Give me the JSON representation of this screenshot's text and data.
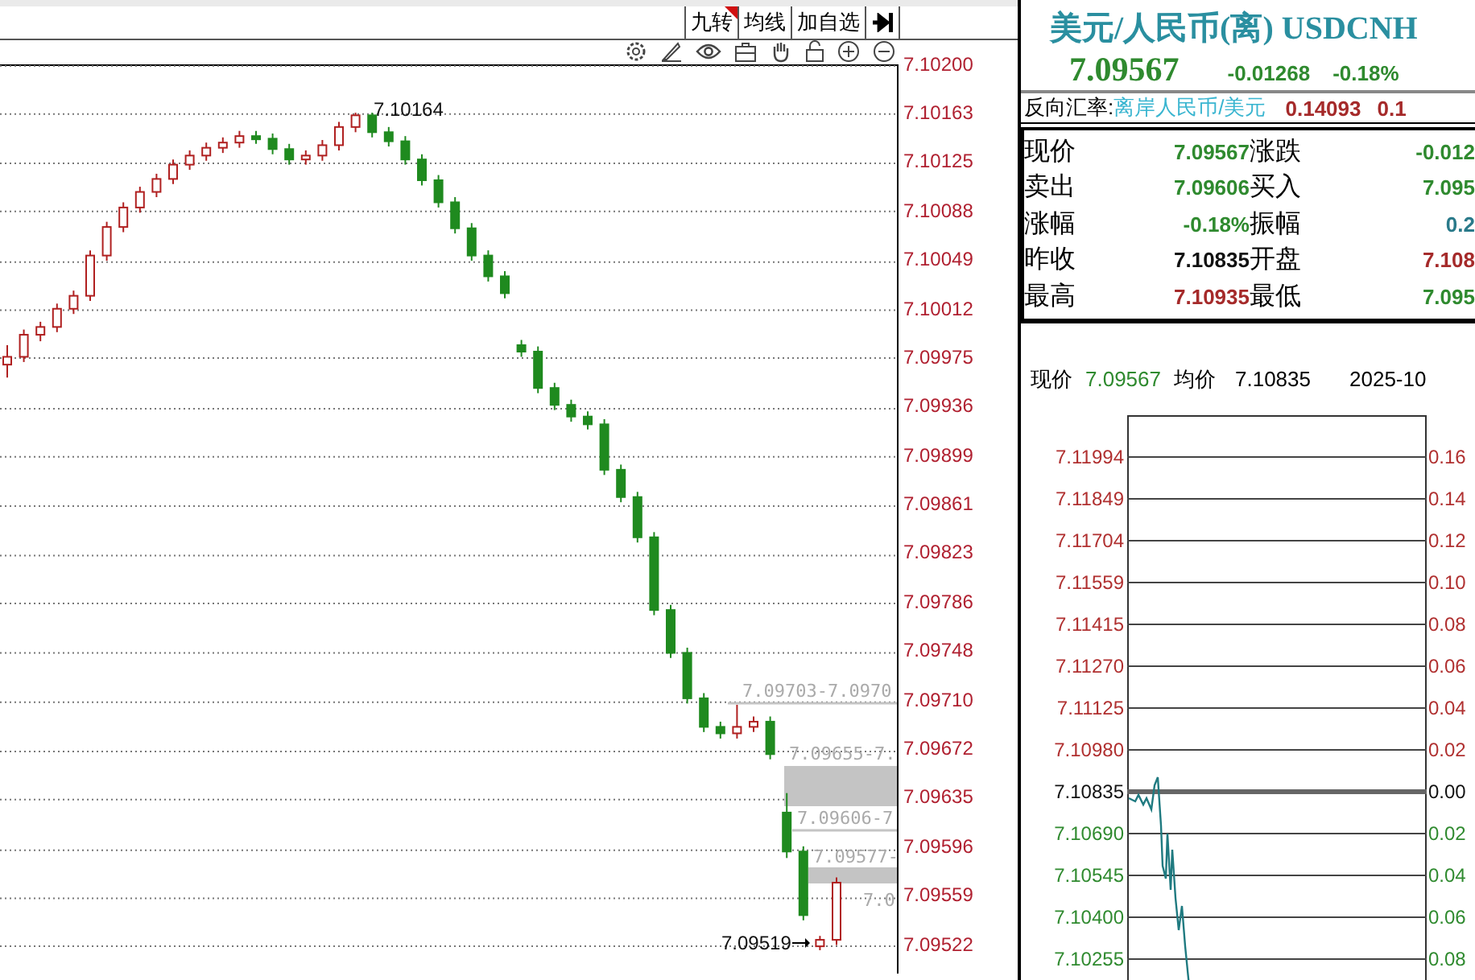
{
  "toolbar": {
    "buttons": [
      {
        "label": "九转",
        "flagged": true
      },
      {
        "label": "均线",
        "flagged": false
      },
      {
        "label": "加自选",
        "flagged": false
      }
    ]
  },
  "kline": {
    "chart_data": {
      "type": "candlestick",
      "ylim": [
        7.09501,
        7.102
      ],
      "grid": true,
      "yticks": [
        {
          "value": 7.102,
          "label": "7.10200"
        },
        {
          "value": 7.10163,
          "label": "7.10163"
        },
        {
          "value": 7.10125,
          "label": "7.10125"
        },
        {
          "value": 7.10088,
          "label": "7.10088"
        },
        {
          "value": 7.10049,
          "label": "7.10049"
        },
        {
          "value": 7.10012,
          "label": "7.10012"
        },
        {
          "value": 7.09975,
          "label": "7.09975"
        },
        {
          "value": 7.09936,
          "label": "7.09936"
        },
        {
          "value": 7.09899,
          "label": "7.09899"
        },
        {
          "value": 7.09861,
          "label": "7.09861"
        },
        {
          "value": 7.09823,
          "label": "7.09823"
        },
        {
          "value": 7.09786,
          "label": "7.09786"
        },
        {
          "value": 7.09748,
          "label": "7.09748"
        },
        {
          "value": 7.0971,
          "label": "7.09710"
        },
        {
          "value": 7.09672,
          "label": "7.09672"
        },
        {
          "value": 7.09635,
          "label": "7.09635"
        },
        {
          "value": 7.09596,
          "label": "7.09596"
        },
        {
          "value": 7.09559,
          "label": "7.09559"
        },
        {
          "value": 7.09522,
          "label": "7.09522"
        }
      ],
      "ohlc": [
        [
          7.0997,
          7.09985,
          7.0996,
          7.09976
        ],
        [
          7.09976,
          7.09997,
          7.09972,
          7.09993
        ],
        [
          7.09993,
          7.10003,
          7.09988,
          7.09999
        ],
        [
          7.09999,
          7.10017,
          7.09995,
          7.10013
        ],
        [
          7.10013,
          7.10027,
          7.10009,
          7.10023
        ],
        [
          7.10023,
          7.10058,
          7.10019,
          7.10054
        ],
        [
          7.10054,
          7.1008,
          7.1005,
          7.10076
        ],
        [
          7.10076,
          7.10095,
          7.10072,
          7.10091
        ],
        [
          7.10091,
          7.10107,
          7.10087,
          7.10103
        ],
        [
          7.10103,
          7.10117,
          7.10099,
          7.10113
        ],
        [
          7.10113,
          7.10128,
          7.10109,
          7.10124
        ],
        [
          7.10124,
          7.10135,
          7.1012,
          7.10131
        ],
        [
          7.10131,
          7.10141,
          7.10127,
          7.10137
        ],
        [
          7.10137,
          7.10145,
          7.10133,
          7.10141
        ],
        [
          7.10141,
          7.1015,
          7.10137,
          7.10146
        ],
        [
          7.10146,
          7.1015,
          7.1014,
          7.10144
        ],
        [
          7.10144,
          7.10148,
          7.10132,
          7.10136
        ],
        [
          7.10136,
          7.1014,
          7.10124,
          7.10128
        ],
        [
          7.10128,
          7.10135,
          7.10124,
          7.10131
        ],
        [
          7.10131,
          7.10143,
          7.10127,
          7.10139
        ],
        [
          7.10139,
          7.10157,
          7.10135,
          7.10153
        ],
        [
          7.10153,
          7.10164,
          7.10149,
          7.10162
        ],
        [
          7.10162,
          7.10164,
          7.10145,
          7.10149
        ],
        [
          7.10149,
          7.10153,
          7.10138,
          7.10142
        ],
        [
          7.10142,
          7.10146,
          7.10124,
          7.10128
        ],
        [
          7.10128,
          7.10132,
          7.10108,
          7.10112
        ],
        [
          7.10112,
          7.10116,
          7.10091,
          7.10095
        ],
        [
          7.10095,
          7.10099,
          7.10071,
          7.10075
        ],
        [
          7.10075,
          7.10079,
          7.1005,
          7.10054
        ],
        [
          7.10054,
          7.10058,
          7.10034,
          7.10038
        ],
        [
          7.10038,
          7.10042,
          7.10021,
          7.10025
        ],
        [
          7.09985,
          7.09989,
          7.09976,
          7.0998
        ],
        [
          7.0998,
          7.09984,
          7.09948,
          7.09952
        ],
        [
          7.09952,
          7.09956,
          7.09935,
          7.09939
        ],
        [
          7.09939,
          7.09943,
          7.09926,
          7.0993
        ],
        [
          7.0993,
          7.09934,
          7.0992,
          7.09924
        ],
        [
          7.09924,
          7.09928,
          7.09885,
          7.09889
        ],
        [
          7.09889,
          7.09893,
          7.09864,
          7.09868
        ],
        [
          7.09868,
          7.09872,
          7.09833,
          7.09837
        ],
        [
          7.09837,
          7.09841,
          7.09777,
          7.09781
        ],
        [
          7.09781,
          7.09785,
          7.09744,
          7.09748
        ],
        [
          7.09748,
          7.09752,
          7.09709,
          7.09713
        ],
        [
          7.09713,
          7.09717,
          7.09687,
          7.09691
        ],
        [
          7.09691,
          7.09695,
          7.09682,
          7.09686
        ],
        [
          7.09686,
          7.09708,
          7.09682,
          7.09691
        ],
        [
          7.09691,
          7.09699,
          7.09687,
          7.09695
        ],
        [
          7.09695,
          7.09699,
          7.09666,
          7.0967
        ],
        [
          7.09625,
          7.0964,
          7.0959,
          7.09595
        ],
        [
          7.09595,
          7.09599,
          7.09542,
          7.09546
        ],
        [
          7.09522,
          7.0953,
          7.09519,
          7.09527
        ],
        [
          7.09527,
          7.09575,
          7.09523,
          7.09571
        ]
      ]
    },
    "high_marker": "7.10164",
    "low_marker": "7.09519",
    "gap_labels": [
      "7.09703-7.0970",
      "7.09655-7.",
      "7.09606-7",
      "7.09577-",
      "7.0"
    ]
  },
  "quote": {
    "title": "美元/人民币(离) USDCNH",
    "price": "7.09567",
    "change": "-0.01268",
    "change_pct": "-0.18%",
    "reverse": {
      "label": "反向汇率:",
      "pair": "离岸人民币/美元",
      "value": "0.14093",
      "value_2": "0.1"
    },
    "rows": [
      {
        "cells": [
          {
            "label": "现价",
            "value": "7.09567",
            "color": "#2f8a2f"
          },
          {
            "label": "涨跌",
            "value": "-0.012",
            "color": "#2f8a2f"
          }
        ]
      },
      {
        "cells": [
          {
            "label": "卖出",
            "value": "7.09606",
            "color": "#2f8a2f"
          },
          {
            "label": "买入",
            "value": "7.095",
            "color": "#2f8a2f"
          }
        ]
      },
      {
        "cells": [
          {
            "label": "涨幅",
            "value": "-0.18%",
            "color": "#2f8a2f"
          },
          {
            "label": "振幅",
            "value": "0.2",
            "color": "#2a7a8a"
          }
        ]
      },
      {
        "cells": [
          {
            "label": "昨收",
            "value": "7.10835",
            "color": "#111111"
          },
          {
            "label": "开盘",
            "value": "7.108",
            "color": "#a52a2a"
          }
        ]
      },
      {
        "cells": [
          {
            "label": "最高",
            "value": "7.10935",
            "color": "#a52a2a"
          },
          {
            "label": "最低",
            "value": "7.095",
            "color": "#2f8a2f"
          }
        ]
      }
    ],
    "summary": {
      "price_label": "现价",
      "price": "7.09567",
      "avg_label": "均价",
      "avg": "7.10835",
      "date": "2025-10"
    }
  },
  "intraday": {
    "left_axis": [
      {
        "text": "7.11994",
        "color": "#b03030"
      },
      {
        "text": "7.11849",
        "color": "#b03030"
      },
      {
        "text": "7.11704",
        "color": "#b03030"
      },
      {
        "text": "7.11559",
        "color": "#b03030"
      },
      {
        "text": "7.11415",
        "color": "#b03030"
      },
      {
        "text": "7.11270",
        "color": "#b03030"
      },
      {
        "text": "7.11125",
        "color": "#b03030"
      },
      {
        "text": "7.10980",
        "color": "#b03030"
      },
      {
        "text": "7.10835",
        "color": "#111111"
      },
      {
        "text": "7.10690",
        "color": "#2f8a2f"
      },
      {
        "text": "7.10545",
        "color": "#2f8a2f"
      },
      {
        "text": "7.10400",
        "color": "#2f8a2f"
      },
      {
        "text": "7.10255",
        "color": "#2f8a2f"
      }
    ],
    "right_axis": [
      {
        "text": "0.16",
        "color": "#b03030"
      },
      {
        "text": "0.14",
        "color": "#b03030"
      },
      {
        "text": "0.12",
        "color": "#b03030"
      },
      {
        "text": "0.10",
        "color": "#b03030"
      },
      {
        "text": "0.08",
        "color": "#b03030"
      },
      {
        "text": "0.06",
        "color": "#b03030"
      },
      {
        "text": "0.04",
        "color": "#b03030"
      },
      {
        "text": "0.02",
        "color": "#b03030"
      },
      {
        "text": "0.00",
        "color": "#111111"
      },
      {
        "text": "0.02",
        "color": "#2f8a2f"
      },
      {
        "text": "0.04",
        "color": "#2f8a2f"
      },
      {
        "text": "0.06",
        "color": "#2f8a2f"
      },
      {
        "text": "0.08",
        "color": "#2f8a2f"
      }
    ]
  }
}
